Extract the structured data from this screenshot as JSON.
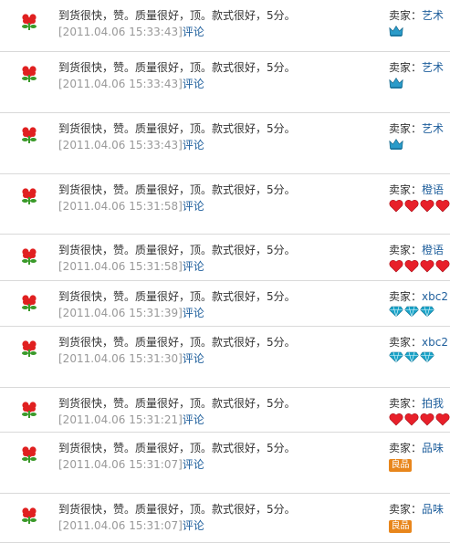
{
  "rows": [
    {
      "comment": "到货很快，赞。质量很好，顶。款式很好，5分。",
      "timestamp": "[2011.04.06 15:33:43]",
      "reply": "评论",
      "seller_label": "卖家：",
      "seller_name": "艺术",
      "rank": "crown",
      "rank_count": 1
    },
    {
      "comment": "到货很快，赞。质量很好，顶。款式很好，5分。",
      "timestamp": "[2011.04.06 15:33:43]",
      "reply": "评论",
      "seller_label": "卖家：",
      "seller_name": "艺术",
      "rank": "crown",
      "rank_count": 1
    },
    {
      "comment": "到货很快，赞。质量很好，顶。款式很好，5分。",
      "timestamp": "[2011.04.06 15:33:43]",
      "reply": "评论",
      "seller_label": "卖家：",
      "seller_name": "艺术",
      "rank": "crown",
      "rank_count": 1
    },
    {
      "comment": "到货很快，赞。质量很好，顶。款式很好，5分。",
      "timestamp": "[2011.04.06 15:31:58]",
      "reply": "评论",
      "seller_label": "卖家：",
      "seller_name": "橙语",
      "rank": "heart",
      "rank_count": 4
    },
    {
      "comment": "到货很快，赞。质量很好，顶。款式很好，5分。",
      "timestamp": "[2011.04.06 15:31:58]",
      "reply": "评论",
      "seller_label": "卖家：",
      "seller_name": "橙语",
      "rank": "heart",
      "rank_count": 4
    },
    {
      "comment": "到货很快，赞。质量很好，顶。款式很好，5分。",
      "timestamp": "[2011.04.06 15:31:39]",
      "reply": "评论",
      "seller_label": "卖家：",
      "seller_name": "xbc2",
      "rank": "diamond",
      "rank_count": 3
    },
    {
      "comment": "到货很快，赞。质量很好，顶。款式很好，5分。",
      "timestamp": "[2011.04.06 15:31:30]",
      "reply": "评论",
      "seller_label": "卖家：",
      "seller_name": "xbc2",
      "rank": "diamond",
      "rank_count": 3
    },
    {
      "comment": "到货很快，赞。质量很好，顶。款式很好，5分。",
      "timestamp": "[2011.04.06 15:31:21]",
      "reply": "评论",
      "seller_label": "卖家：",
      "seller_name": "拍我",
      "rank": "heart",
      "rank_count": 4
    },
    {
      "comment": "到货很快，赞。质量很好，顶。款式很好，5分。",
      "timestamp": "[2011.04.06 15:31:07]",
      "reply": "评论",
      "seller_label": "卖家：",
      "seller_name": "品味",
      "rank": "badge",
      "badge_text": "良品"
    },
    {
      "comment": "到货很快，赞。质量很好，顶。款式很好，5分。",
      "timestamp": "[2011.04.06 15:31:07]",
      "reply": "评论",
      "seller_label": "卖家：",
      "seller_name": "品味",
      "rank": "badge",
      "badge_text": "良品"
    }
  ],
  "colors": {
    "link": "#1f5f9c",
    "timestamp": "#999999",
    "heart": "#e8202a",
    "diamond": "#1aa3c8",
    "crown": "#2a9bc9",
    "badge": "#e8861c",
    "flower": "#e02020",
    "leaf": "#3a9a2a"
  },
  "icons": {
    "flower": "flower-icon",
    "crown": "crown-icon",
    "heart": "heart-icon",
    "diamond": "diamond-icon"
  }
}
